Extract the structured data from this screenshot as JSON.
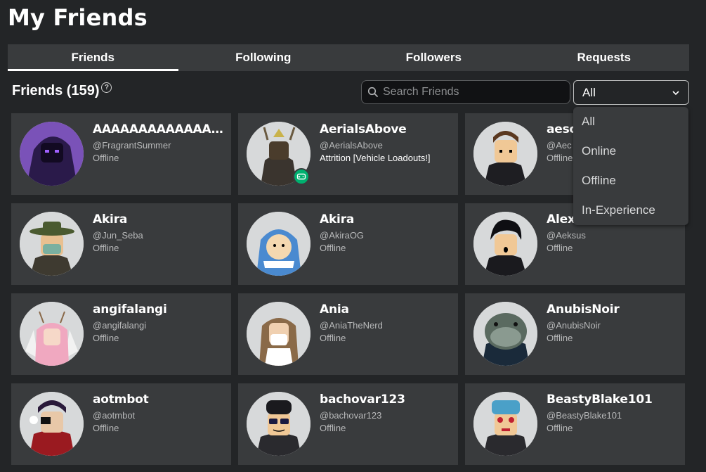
{
  "page": {
    "title": "My Friends"
  },
  "tabs": [
    {
      "label": "Friends",
      "active": true
    },
    {
      "label": "Following",
      "active": false
    },
    {
      "label": "Followers",
      "active": false
    },
    {
      "label": "Requests",
      "active": false
    }
  ],
  "section": {
    "heading": "Friends (159)",
    "help_icon": "question-circle-icon"
  },
  "search": {
    "placeholder": "Search Friends",
    "value": ""
  },
  "filter": {
    "selected": "All",
    "options": [
      "All",
      "Online",
      "Offline",
      "In-Experience"
    ]
  },
  "colors": {
    "background": "#232527",
    "card": "#393b3d",
    "ingame_badge": "#00b06f"
  },
  "friends": [
    {
      "name": "AAAAAAAAAAAAA...",
      "handle": "@FragrantSummer",
      "status": "Offline",
      "ingame": false
    },
    {
      "name": "AerialsAbove",
      "handle": "@AerialsAbove",
      "status": "Attrition [Vehicle Loadouts!]",
      "ingame": true
    },
    {
      "name": "aesc",
      "handle": "@Aec",
      "status": "Offline",
      "ingame": false
    },
    {
      "name": "Akira",
      "handle": "@Jun_Seba",
      "status": "Offline",
      "ingame": false
    },
    {
      "name": "Akira",
      "handle": "@AkiraOG",
      "status": "Offline",
      "ingame": false
    },
    {
      "name": "Alex",
      "handle": "@Aeksus",
      "status": "Offline",
      "ingame": false
    },
    {
      "name": "angifalangi",
      "handle": "@angifalangi",
      "status": "Offline",
      "ingame": false
    },
    {
      "name": "Ania",
      "handle": "@AniaTheNerd",
      "status": "Offline",
      "ingame": false
    },
    {
      "name": "AnubisNoir",
      "handle": "@AnubisNoir",
      "status": "Offline",
      "ingame": false
    },
    {
      "name": "aotmbot",
      "handle": "@aotmbot",
      "status": "Offline",
      "ingame": false
    },
    {
      "name": "bachovar123",
      "handle": "@bachovar123",
      "status": "Offline",
      "ingame": false
    },
    {
      "name": "BeastyBlake101",
      "handle": "@BeastyBlake101",
      "status": "Offline",
      "ingame": false
    }
  ]
}
